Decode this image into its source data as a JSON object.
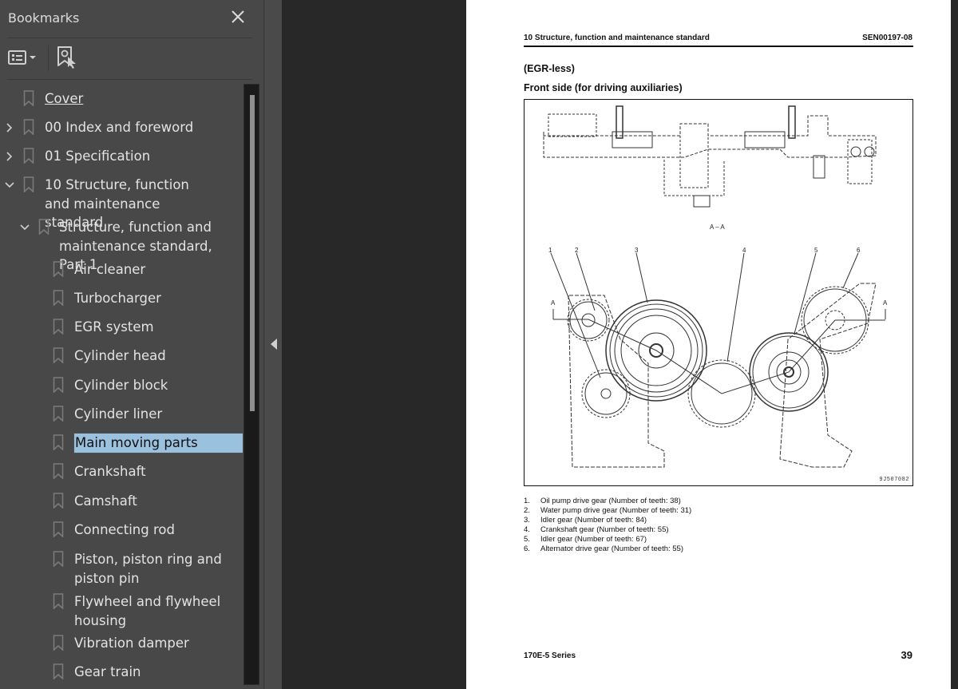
{
  "sidebar": {
    "title": "Bookmarks",
    "close_icon": "close-icon",
    "toolbar": {
      "options_icon": "list-options-icon",
      "options_dropdown_icon": "caret-down-icon",
      "find_bookmark_icon": "find-current-bookmark-icon"
    },
    "bookmarks": [
      {
        "label": "Cover",
        "level": 0,
        "expander": "none",
        "state": "hover-underlined"
      },
      {
        "label": "00 Index and foreword",
        "level": 0,
        "expander": "collapsed"
      },
      {
        "label": "01 Specification",
        "level": 0,
        "expander": "collapsed"
      },
      {
        "label": "10 Structure, function and maintenance standard",
        "level": 0,
        "expander": "expanded"
      },
      {
        "label": "Structure, function and maintenance standard, Part 1",
        "level": 1,
        "expander": "expanded"
      },
      {
        "label": "Air cleaner",
        "level": 2,
        "expander": "none"
      },
      {
        "label": "Turbocharger",
        "level": 2,
        "expander": "none"
      },
      {
        "label": "EGR system",
        "level": 2,
        "expander": "none"
      },
      {
        "label": "Cylinder head",
        "level": 2,
        "expander": "none"
      },
      {
        "label": "Cylinder block",
        "level": 2,
        "expander": "none"
      },
      {
        "label": "Cylinder liner",
        "level": 2,
        "expander": "none"
      },
      {
        "label": "Main moving parts",
        "level": 2,
        "expander": "none",
        "state": "selected"
      },
      {
        "label": "Crankshaft",
        "level": 2,
        "expander": "none"
      },
      {
        "label": "Camshaft",
        "level": 2,
        "expander": "none"
      },
      {
        "label": "Connecting rod",
        "level": 2,
        "expander": "none"
      },
      {
        "label": "Piston, piston ring and piston pin",
        "level": 2,
        "expander": "none"
      },
      {
        "label": "Flywheel and flywheel housing",
        "level": 2,
        "expander": "none"
      },
      {
        "label": "Vibration damper",
        "level": 2,
        "expander": "none"
      },
      {
        "label": "Gear train",
        "level": 2,
        "expander": "none"
      }
    ],
    "collapse_icon": "collapse-panel-arrow-icon"
  },
  "colors": {
    "panel_bg": "#484848",
    "viewer_bg": "#282828",
    "selection": "#9ac1de",
    "text": "#e3e3e3"
  },
  "document": {
    "header_left": "10 Structure, function and maintenance standard",
    "header_right": "SEN00197-08",
    "subtitle1": "(EGR-less)",
    "subtitle2": "Front side (for driving auxiliaries)",
    "figure": {
      "section_label": "A – A",
      "arrow_label": "A",
      "callouts": [
        "1",
        "2",
        "3",
        "4",
        "5",
        "6"
      ],
      "code": "9J507082"
    },
    "legend": [
      {
        "num": "1.",
        "text": "Oil pump drive gear (Number of teeth: 38)"
      },
      {
        "num": "2.",
        "text": "Water pump drive gear (Number of teeth: 31)"
      },
      {
        "num": "3.",
        "text": "Idler gear (Number of teeth: 84)"
      },
      {
        "num": "4.",
        "text": "Crankshaft gear (Number of teeth: 55)"
      },
      {
        "num": "5.",
        "text": "Idler gear (Number of teeth: 67)"
      },
      {
        "num": "6.",
        "text": "Alternator drive gear (Number of teeth: 55)"
      }
    ],
    "footer_left": "170E-5 Series",
    "page_number": "39"
  }
}
